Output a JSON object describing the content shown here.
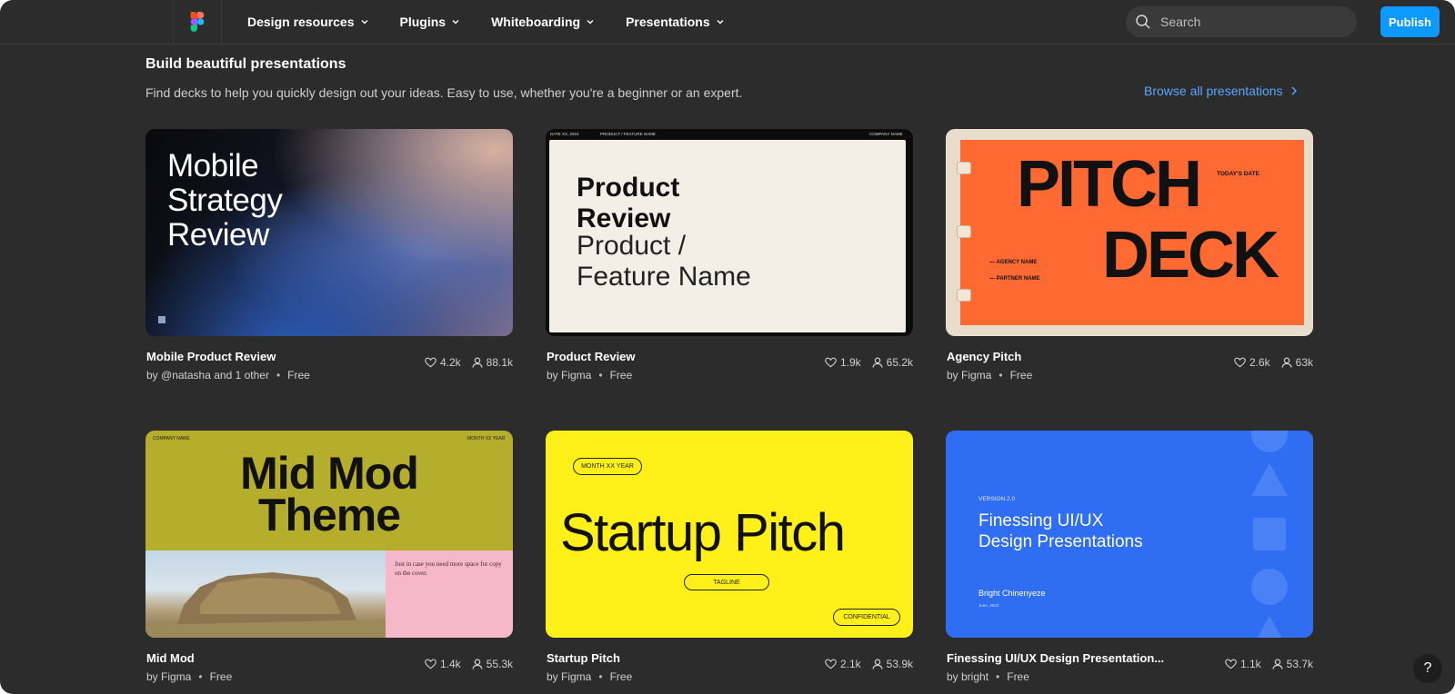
{
  "nav": {
    "items": [
      {
        "label": "Design resources"
      },
      {
        "label": "Plugins"
      },
      {
        "label": "Whiteboarding"
      },
      {
        "label": "Presentations"
      }
    ],
    "search_placeholder": "Search",
    "publish_label": "Publish"
  },
  "section": {
    "title": "Build beautiful presentations",
    "description": "Find decks to help you quickly design out your ideas. Easy to use, whether you're a beginner or an expert.",
    "browse_label": "Browse all presentations"
  },
  "cards": [
    {
      "title": "Mobile Product Review",
      "author": "by @natasha and 1 other",
      "price": "Free",
      "likes": "4.2k",
      "users": "88.1k",
      "thumb": {
        "heading_lines": [
          "Mobile",
          "Strategy",
          "Review"
        ]
      }
    },
    {
      "title": "Product Review",
      "author": "by Figma",
      "price": "Free",
      "likes": "1.9k",
      "users": "65.2k",
      "thumb": {
        "top_left": "DATE XX, 2024",
        "top_mid": "PRODUCT / FEATURE NAME",
        "top_right": "COMPANY NAME",
        "bold_lines": [
          "Product",
          "Review"
        ],
        "light_lines": [
          "Product /",
          "Feature Name"
        ]
      }
    },
    {
      "title": "Agency Pitch",
      "author": "by Figma",
      "price": "Free",
      "likes": "2.6k",
      "users": "63k",
      "thumb": {
        "word1": "PITCH",
        "word2": "DECK",
        "date": "TODAY'S DATE",
        "agency": "— AGENCY NAME",
        "partner": "— PARTNER NAME"
      }
    },
    {
      "title": "Mid Mod",
      "author": "by Figma",
      "price": "Free",
      "likes": "1.4k",
      "users": "55.3k",
      "thumb": {
        "company": "COMPANY NAME",
        "month": "MONTH XX YEAR",
        "heading_lines": [
          "Mid Mod",
          "Theme"
        ],
        "note": "Just in case you need more space for copy on the cover."
      }
    },
    {
      "title": "Startup Pitch",
      "author": "by Figma",
      "price": "Free",
      "likes": "2.1k",
      "users": "53.9k",
      "thumb": {
        "month": "MONTH XX YEAR",
        "heading": "Startup Pitch",
        "tagline": "TAGLINE",
        "confidential": "CONFIDENTIAL"
      }
    },
    {
      "title": "Finessing UI/UX Design Presentation...",
      "author": "by bright",
      "price": "Free",
      "likes": "1.1k",
      "users": "53.7k",
      "thumb": {
        "version": "VERSION 2.0",
        "heading_lines": [
          "Finessing UI/UX",
          "Design Presentations"
        ],
        "name": "Bright Chinenyeze",
        "date": "June, 2024"
      }
    }
  ],
  "help_label": "?",
  "colors": {
    "background": "#2c2c2c",
    "accent": "#0d99ff",
    "link": "#5aa7ff"
  }
}
